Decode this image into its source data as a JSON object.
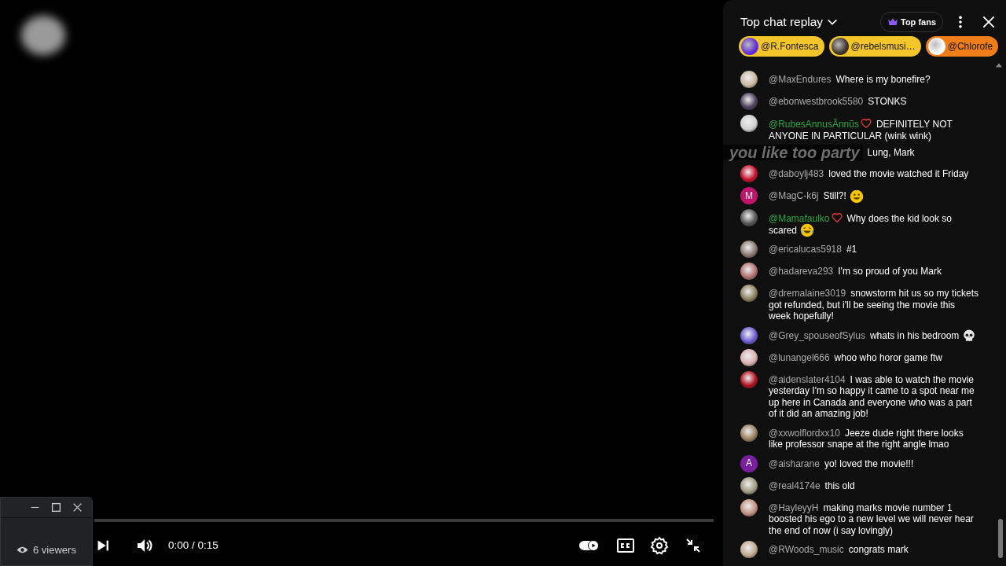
{
  "chat": {
    "title": "Top chat replay",
    "top_fans_label": "Top fans",
    "chips": [
      {
        "handle": "@R.Fontesca",
        "color": "#f4c62a"
      },
      {
        "handle": "@rebelsmusi…",
        "color": "#f4c62a"
      },
      {
        "handle": "@Chlorofe",
        "color": "#ee7d1a"
      }
    ],
    "messages": [
      {
        "kind": "text",
        "author": "@MaxEndures",
        "member": false,
        "text": "Where is my bonefire?"
      },
      {
        "kind": "text",
        "author": "@ebonwestbrook5580",
        "member": false,
        "text": "STONKS"
      },
      {
        "kind": "text",
        "author": "@RubesAnnusÃnnũs",
        "member": true,
        "text": "DEFINITELY NOT ANYONE IN PARTICULAR (wink wink)"
      },
      {
        "kind": "covered",
        "caption": "you like too party",
        "text": "Lung, Mark"
      },
      {
        "kind": "text",
        "author": "@daboylj483",
        "member": false,
        "text": "loved the movie watched it Friday"
      },
      {
        "kind": "smile",
        "author": "@MagC-k6j",
        "member": false,
        "text": "Still?!",
        "avatar_letter": "M",
        "color": "#c0136b"
      },
      {
        "kind": "laugh",
        "author": "@Mamafaulko",
        "member": true,
        "text": "Why does the kid look so scared"
      },
      {
        "kind": "text",
        "author": "@ericalucas5918",
        "member": false,
        "text": "#1"
      },
      {
        "kind": "text",
        "author": "@hadareva293",
        "member": false,
        "text": "I'm so proud of you Mark"
      },
      {
        "kind": "text",
        "author": "@dremalaine3019",
        "member": false,
        "text": "snowstorm hit us so my tickets got refunded, but i'll be seeing the movie this week hopefully!"
      },
      {
        "kind": "skull",
        "author": "@Grey_spouseofSylus",
        "member": false,
        "text": "whats in his bedroom"
      },
      {
        "kind": "text",
        "author": "@lunangel666",
        "member": false,
        "text": "whoo who horor game ftw"
      },
      {
        "kind": "text",
        "author": "@aidenslater4104",
        "member": false,
        "text": "I was able to watch the movie yesterday I'm so happy it came to a spot near me up here in Canada and everyone who was a part of it did an amazing job!"
      },
      {
        "kind": "text",
        "author": "@xxwolflordxx10",
        "member": false,
        "text": "Jeeze dude right there looks like professor snape at the right angle lmao"
      },
      {
        "kind": "text",
        "author": "@aisharane",
        "member": false,
        "text": "yo! loved the movie!!!",
        "avatar_letter": "A",
        "color": "#7b1fa2"
      },
      {
        "kind": "text",
        "author": "@real4174e",
        "member": false,
        "text": "this old"
      },
      {
        "kind": "text",
        "author": "@HayleyyH",
        "member": false,
        "text": "making marks movie number 1 boosted his ego to a new level we will never hear the end of now (i say lovingly)"
      },
      {
        "kind": "text",
        "author": "@RWoods_music",
        "member": false,
        "text": "congrats mark"
      }
    ]
  },
  "player": {
    "progress": {
      "level": 0
    },
    "time": "0:00 / 0:15",
    "autoplay": {
      "on": true
    }
  },
  "mini_window": {
    "viewers": "6 viewers"
  }
}
